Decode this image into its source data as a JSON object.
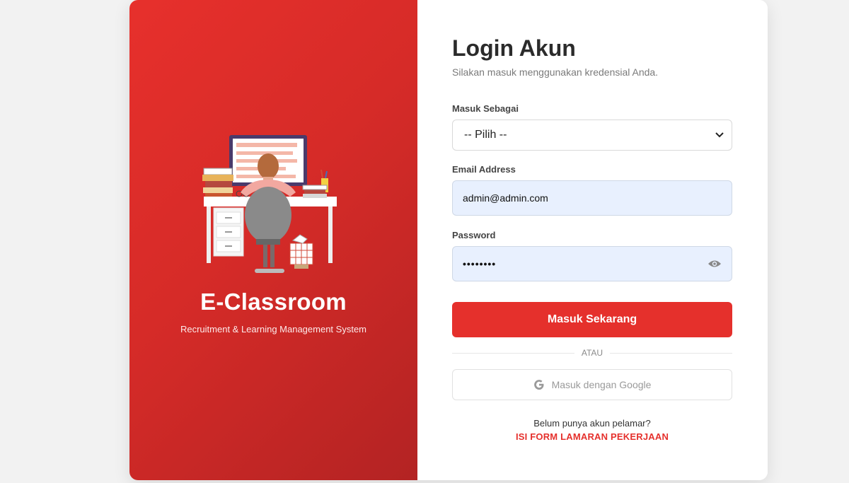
{
  "brand": {
    "title": "E-Classroom",
    "subtitle": "Recruitment & Learning Management System",
    "illustration_icon": "person-at-desk-illustration",
    "colors": {
      "primary": "#e5302c",
      "primary_dark": "#b32323"
    }
  },
  "login": {
    "title": "Login Akun",
    "subtitle": "Silakan masuk menggunakan kredensial Anda."
  },
  "role_select": {
    "label": "Masuk Sebagai",
    "selected": "-- Pilih --",
    "icon": "chevron-down-icon"
  },
  "email": {
    "label": "Email Address",
    "value": "admin@admin.com"
  },
  "password": {
    "label": "Password",
    "masked_value": "••••••••",
    "toggle_icon": "eye-icon"
  },
  "submit": {
    "label": "Masuk Sekarang"
  },
  "divider": {
    "label": "ATAU"
  },
  "google": {
    "label": "Masuk dengan Google",
    "icon": "google-icon"
  },
  "register": {
    "question": "Belum punya akun pelamar?",
    "link": "ISI FORM LAMARAN PEKERJAAN"
  }
}
